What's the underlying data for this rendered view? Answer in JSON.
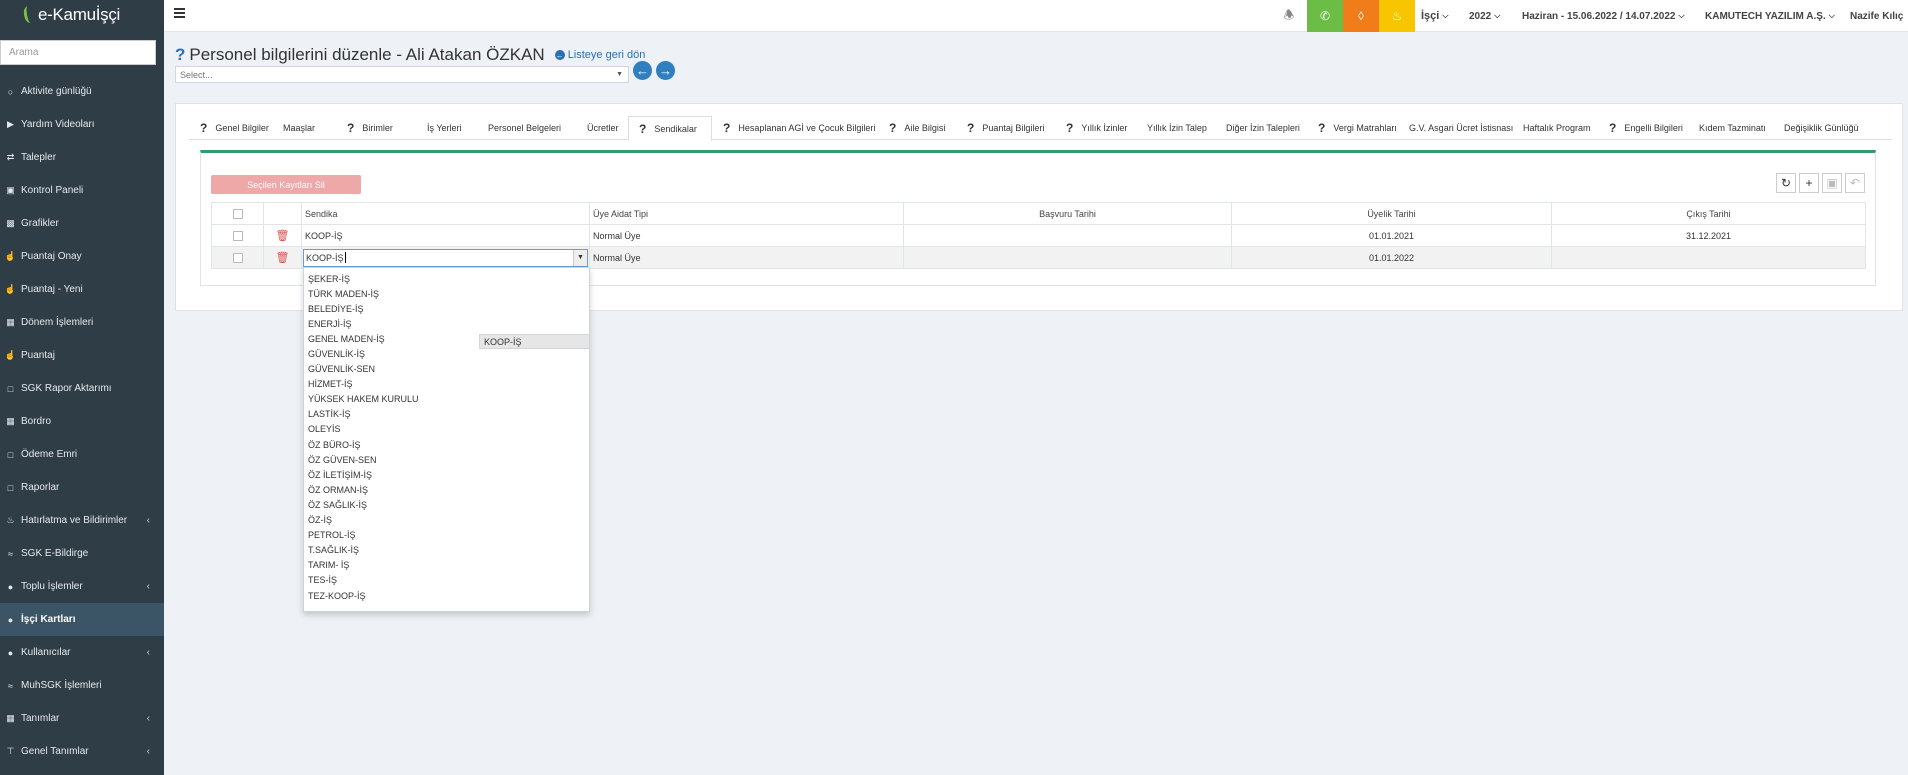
{
  "sidebar": {
    "logo": "e-Kamuİşçi",
    "search_placeholder": "Arama",
    "items": [
      {
        "label": "Aktivite günlüğü",
        "icon": "circle-icon",
        "chev": false
      },
      {
        "label": "Yardım Videoları",
        "icon": "video-icon",
        "chev": false
      },
      {
        "label": "Talepler",
        "icon": "exchange-icon",
        "chev": false
      },
      {
        "label": "Kontrol Paneli",
        "icon": "monitor-icon",
        "chev": false
      },
      {
        "label": "Grafikler",
        "icon": "chart-icon",
        "chev": false
      },
      {
        "label": "Puantaj Onay",
        "icon": "hand-icon",
        "chev": false
      },
      {
        "label": "Puantaj - Yeni",
        "icon": "hand-icon",
        "chev": false
      },
      {
        "label": "Dönem İşlemleri",
        "icon": "book-icon",
        "chev": false
      },
      {
        "label": "Puantaj",
        "icon": "hand-icon",
        "chev": false
      },
      {
        "label": "SGK Rapor Aktarımı",
        "icon": "file-icon",
        "chev": false
      },
      {
        "label": "Bordro",
        "icon": "book-icon",
        "chev": false
      },
      {
        "label": "Ödeme Emri",
        "icon": "file-icon",
        "chev": false
      },
      {
        "label": "Raporlar",
        "icon": "file-icon",
        "chev": false
      },
      {
        "label": "Hatırlatma ve Bildirimler",
        "icon": "bell-icon",
        "chev": true
      },
      {
        "label": "SGK E-Bildirge",
        "icon": "rss-icon",
        "chev": false
      },
      {
        "label": "Toplu İşlemler",
        "icon": "user-icon",
        "chev": true
      },
      {
        "label": "İşçi Kartları",
        "icon": "users-icon",
        "chev": false,
        "active": true
      },
      {
        "label": "Kullanıcılar",
        "icon": "user-icon",
        "chev": true
      },
      {
        "label": "MuhSGK İşlemleri",
        "icon": "rss-icon",
        "chev": false
      },
      {
        "label": "Tanımlar",
        "icon": "book-icon",
        "chev": true
      },
      {
        "label": "Genel Tanımlar",
        "icon": "signpost-icon",
        "chev": true
      }
    ]
  },
  "topbar": {
    "user_type": "İşçi",
    "year": "2022",
    "period": "Haziran - 15.06.2022 / 14.07.2022",
    "company": "KAMUTECH YAZILIM A.Ş.",
    "user": "Nazife Kılıç",
    "colors": {
      "phone": "#6cbd45",
      "tag": "#f07d1a",
      "bell": "#f7c600"
    }
  },
  "page": {
    "title": "Personel bilgilerini düzenle - Ali Atakan ÖZKAN",
    "back_link": "Listeye geri dön",
    "select_placeholder": "Select..."
  },
  "tabs": [
    {
      "label": "Genel Bilgiler",
      "q": true
    },
    {
      "label": "Maaşlar",
      "q": false
    },
    {
      "label": "Birimler",
      "q": true
    },
    {
      "label": "İş Yerleri",
      "q": false
    },
    {
      "label": "Personel Belgeleri",
      "q": false
    },
    {
      "label": "Ücretler",
      "q": false
    },
    {
      "label": "Sendikalar",
      "q": true,
      "active": true
    },
    {
      "label": "Hesaplanan AGİ ve Çocuk Bilgileri",
      "q": true
    },
    {
      "label": "Aile Bilgisi",
      "q": true
    },
    {
      "label": "Puantaj Bilgileri",
      "q": true
    },
    {
      "label": "Yıllık İzinler",
      "q": true
    },
    {
      "label": "Yıllık İzin Talep",
      "q": false
    },
    {
      "label": "Diğer İzin Talepleri",
      "q": false
    },
    {
      "label": "Vergi Matrahları",
      "q": true
    },
    {
      "label": "G.V. Asgari Ücret İstisnası",
      "q": false
    },
    {
      "label": "Haftalık Program",
      "q": false
    },
    {
      "label": "Engelli Bilgileri",
      "q": true
    },
    {
      "label": "Kıdem Tazminatı",
      "q": false
    },
    {
      "label": "Değişiklik Günlüğü",
      "q": false
    }
  ],
  "grid": {
    "delete_button": "Seçilen Kayıtları Sil",
    "columns": [
      "Sendika",
      "Üye Aidat Tipi",
      "Başvuru Tarihi",
      "Üyelik Tarihi",
      "Çıkış Tarihi"
    ],
    "rows": [
      {
        "sendika": "KOOP-İŞ",
        "aidat": "Normal Üye",
        "basvuru": "",
        "uyelik": "01.01.2021",
        "cikis": "31.12.2021"
      },
      {
        "sendika": "KOOP-İŞ",
        "aidat": "Normal Üye",
        "basvuru": "",
        "uyelik": "01.01.2022",
        "cikis": ""
      }
    ]
  },
  "dropdown": {
    "options": [
      "ŞEKER-İŞ",
      "TÜRK MADEN-İŞ",
      "BELEDİYE-İŞ",
      "ENERJİ-İŞ",
      "GENEL MADEN-İŞ",
      "GÜVENLİK-İŞ",
      "GÜVENLİK-SEN",
      "HİZMET-İŞ",
      "YÜKSEK HAKEM KURULU",
      "KOOP-İŞ",
      "LASTİK-İŞ",
      "OLEYİS",
      "ÖZ BÜRO-İŞ",
      "ÖZ GÜVEN-SEN",
      "ÖZ İLETİŞİM-İŞ",
      "ÖZ ORMAN-İŞ",
      "ÖZ SAĞLIK-İŞ",
      "ÖZ-İŞ",
      "PETROL-İŞ",
      "T.SAĞLIK-İŞ",
      "TARIM- İŞ",
      "TES-İŞ",
      "TEZ-KOOP-İŞ"
    ],
    "selected": "KOOP-İŞ"
  }
}
